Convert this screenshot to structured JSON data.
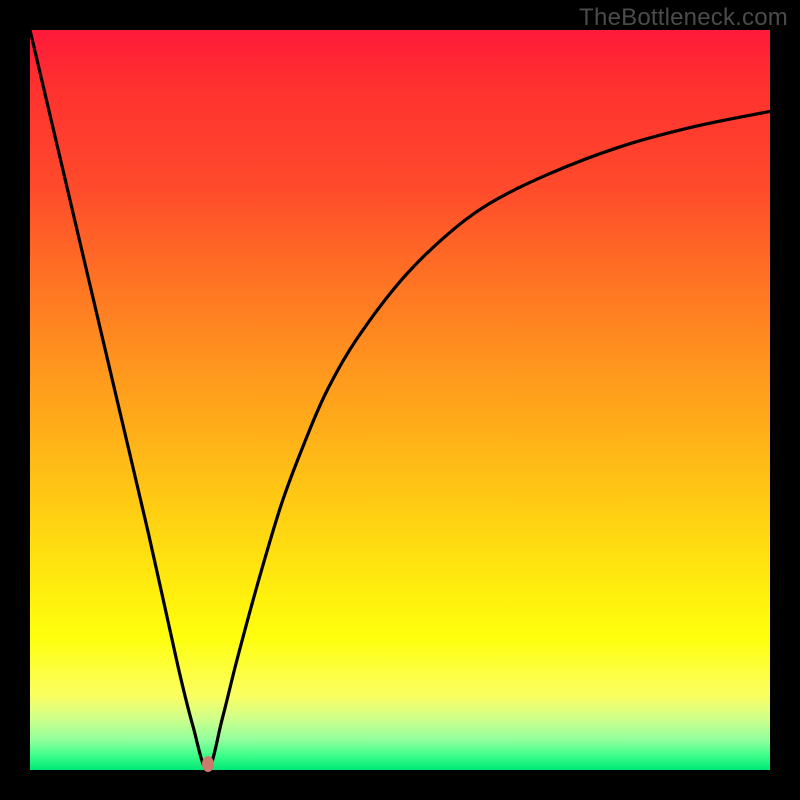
{
  "watermark": "TheBottleneck.com",
  "chart_data": {
    "type": "line",
    "title": "",
    "xlabel": "",
    "ylabel": "",
    "x_range": [
      0,
      100
    ],
    "y_range": [
      0,
      100
    ],
    "minimum_point": {
      "x": 24,
      "y": 0
    },
    "series": [
      {
        "name": "curve",
        "x": [
          0,
          4,
          8,
          12,
          16,
          20,
          22,
          24,
          26,
          28,
          31,
          34,
          37,
          40,
          44,
          50,
          56,
          62,
          70,
          80,
          90,
          100
        ],
        "y": [
          100,
          83,
          66,
          49,
          32,
          14,
          6,
          0,
          7,
          15,
          26,
          36,
          44,
          51,
          58,
          66,
          72,
          76.5,
          80.5,
          84.3,
          87,
          89
        ]
      }
    ],
    "marker": {
      "x": 24,
      "y": 0.8,
      "color": "#cb7b6d"
    },
    "background_gradient": {
      "top": "#ff1a3a",
      "mid": "#ffc814",
      "bottom": "#00e876"
    },
    "grid": false,
    "legend": false
  }
}
